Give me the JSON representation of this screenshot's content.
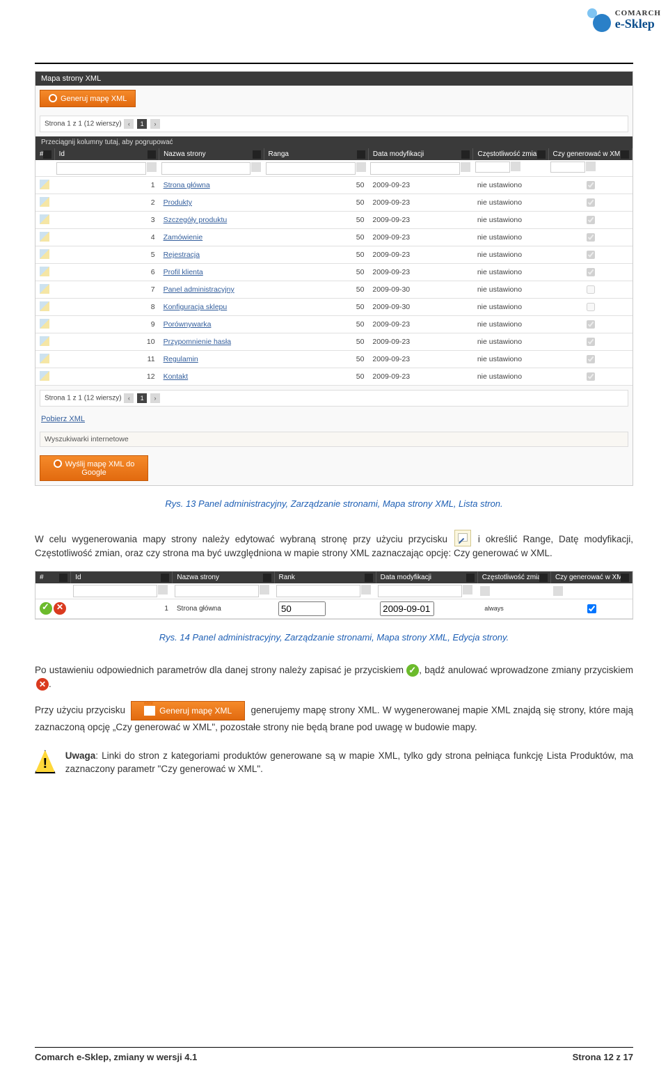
{
  "logo": {
    "brand": "COMARCH",
    "product": "e-Sklep"
  },
  "screenshot": {
    "titlebar": "Mapa strony XML",
    "generate_btn": "Generuj mapę XML",
    "pager_text": "Strona 1 z 1 (12 wierszy)",
    "group_text": "Przeciągnij kolumny tutaj, aby pogrupować",
    "headers": [
      "#",
      "Id",
      "Nazwa strony",
      "Ranga",
      "Data modyfikacji",
      "Częstotliwość zmian",
      "Czy generować w XML"
    ],
    "rows": [
      {
        "id": "1",
        "name": "Strona główna",
        "rank": "50",
        "date": "2009-09-23",
        "freq": "nie ustawiono",
        "xml": true
      },
      {
        "id": "2",
        "name": "Produkty",
        "rank": "50",
        "date": "2009-09-23",
        "freq": "nie ustawiono",
        "xml": true
      },
      {
        "id": "3",
        "name": "Szczegóły produktu",
        "rank": "50",
        "date": "2009-09-23",
        "freq": "nie ustawiono",
        "xml": true
      },
      {
        "id": "4",
        "name": "Zamówienie",
        "rank": "50",
        "date": "2009-09-23",
        "freq": "nie ustawiono",
        "xml": true
      },
      {
        "id": "5",
        "name": "Rejestracja",
        "rank": "50",
        "date": "2009-09-23",
        "freq": "nie ustawiono",
        "xml": true
      },
      {
        "id": "6",
        "name": "Profil klienta",
        "rank": "50",
        "date": "2009-09-23",
        "freq": "nie ustawiono",
        "xml": true
      },
      {
        "id": "7",
        "name": "Panel administracyjny",
        "rank": "50",
        "date": "2009-09-30",
        "freq": "nie ustawiono",
        "xml": false
      },
      {
        "id": "8",
        "name": "Konfiguracja sklepu",
        "rank": "50",
        "date": "2009-09-30",
        "freq": "nie ustawiono",
        "xml": false
      },
      {
        "id": "9",
        "name": "Porównywarka",
        "rank": "50",
        "date": "2009-09-23",
        "freq": "nie ustawiono",
        "xml": true
      },
      {
        "id": "10",
        "name": "Przypomnienie hasła",
        "rank": "50",
        "date": "2009-09-23",
        "freq": "nie ustawiono",
        "xml": true
      },
      {
        "id": "11",
        "name": "Regulamin",
        "rank": "50",
        "date": "2009-09-23",
        "freq": "nie ustawiono",
        "xml": true
      },
      {
        "id": "12",
        "name": "Kontakt",
        "rank": "50",
        "date": "2009-09-23",
        "freq": "nie ustawiono",
        "xml": true
      }
    ],
    "download_link": "Pobierz XML",
    "searchengines_label": "Wyszukiwarki internetowe",
    "send_btn": "Wyślij mapę XML do Google"
  },
  "caption1": "Rys. 13 Panel administracyjny, Zarządzanie stronami, Mapa strony XML, Lista stron.",
  "para1a": "W celu wygenerowania mapy strony należy edytować wybraną stronę przy użyciu przycisku ",
  "para1b": " i określić Range, Datę modyfikacji, Częstotliwość zmian, oraz czy strona ma być uwzględniona w mapie strony XML zaznaczając opcję: Czy generować w XML.",
  "screenshot2": {
    "headers": [
      "#",
      "Id",
      "Nazwa strony",
      "Rank",
      "Data modyfikacji",
      "Częstotliwość zmian",
      "Czy generować w XML"
    ],
    "row": {
      "id": "1",
      "name": "Strona główna",
      "rank": "50",
      "date": "2009-09-01",
      "freq": "always",
      "xml": true
    }
  },
  "caption2": "Rys. 14 Panel administracyjny, Zarządzanie stronami, Mapa strony XML, Edycja strony.",
  "para2a": "Po ustawieniu odpowiednich parametrów dla danej strony należy zapisać je przyciskiem ",
  "para2b": ", bądź anulować wprowadzone zmiany przyciskiem ",
  "para2c": ".",
  "para3a": "Przy użyciu przycisku ",
  "generate_btn_inline": "Generuj mapę XML",
  "para3b": " generujemy mapę strony XML. W wygenerowanej mapie XML znajdą się strony, które mają zaznaczoną opcję „Czy generować w XML\", pozostałe strony nie będą brane pod uwagę w budowie mapy.",
  "note_strong": "Uwaga",
  "note_text": ": Linki do stron z kategoriami produktów generowane są w mapie XML, tylko gdy strona pełniąca funkcję Lista Produktów, ma zaznaczony parametr \"Czy generować w XML\".",
  "footer_left": "Comarch e-Sklep, zmiany w wersji 4.1",
  "footer_right": "Strona 12 z 17"
}
